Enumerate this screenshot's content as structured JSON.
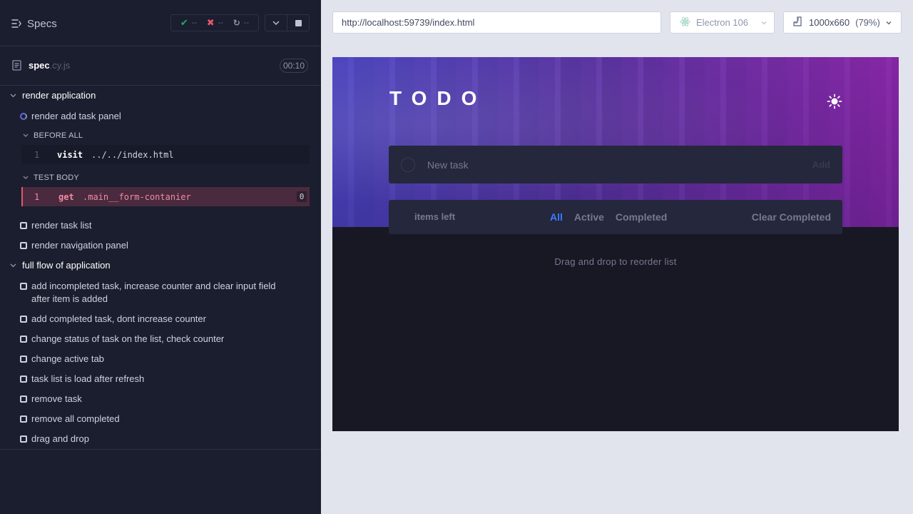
{
  "reporter": {
    "header": {
      "specs_label": "Specs",
      "passed": "--",
      "failed": "--",
      "pending": "--"
    },
    "spec": {
      "name": "spec",
      "ext": ".cy.js",
      "duration": "00:10"
    },
    "suites": [
      {
        "title": "render application",
        "tests": [
          {
            "title": "render add task panel",
            "state": "running",
            "hooks": [
              {
                "title": "BEFORE ALL",
                "commands": [
                  {
                    "num": "1",
                    "name": "visit",
                    "message": "../../index.html"
                  }
                ]
              },
              {
                "title": "TEST BODY",
                "commands": [
                  {
                    "num": "1",
                    "name": "get",
                    "message": ".main__form-contanier",
                    "badge": "0"
                  }
                ]
              }
            ]
          },
          {
            "title": "render task list",
            "state": "pending"
          },
          {
            "title": "render navigation panel",
            "state": "pending"
          }
        ]
      },
      {
        "title": "full flow of application",
        "tests": [
          {
            "title": "add incompleted task, increase counter and clear input field after item is added",
            "state": "pending"
          },
          {
            "title": "add completed task, dont increase counter",
            "state": "pending"
          },
          {
            "title": "change status of task on the list, check counter",
            "state": "pending"
          },
          {
            "title": "change active tab",
            "state": "pending"
          },
          {
            "title": "task list is load after refresh",
            "state": "pending"
          },
          {
            "title": "remove task",
            "state": "pending"
          },
          {
            "title": "remove all completed",
            "state": "pending"
          },
          {
            "title": "drag and drop",
            "state": "pending"
          }
        ]
      }
    ]
  },
  "aut_bar": {
    "url": "http://localhost:59739/index.html",
    "browser": "Electron 106",
    "viewport": "1000x660",
    "scale": "(79%)"
  },
  "app": {
    "title": "TODO",
    "new_task_placeholder": "New task",
    "add_label": "Add",
    "items_left": "items left",
    "tabs": [
      "All",
      "Active",
      "Completed"
    ],
    "clear_completed": "Clear Completed",
    "drag_hint": "Drag and drop to reorder list"
  },
  "colors": {
    "reporter_bg": "#1b1e2e",
    "pass": "#1fa971",
    "fail": "#e45770",
    "accent_blue": "#3a7cfd",
    "app_card": "#25273d"
  }
}
